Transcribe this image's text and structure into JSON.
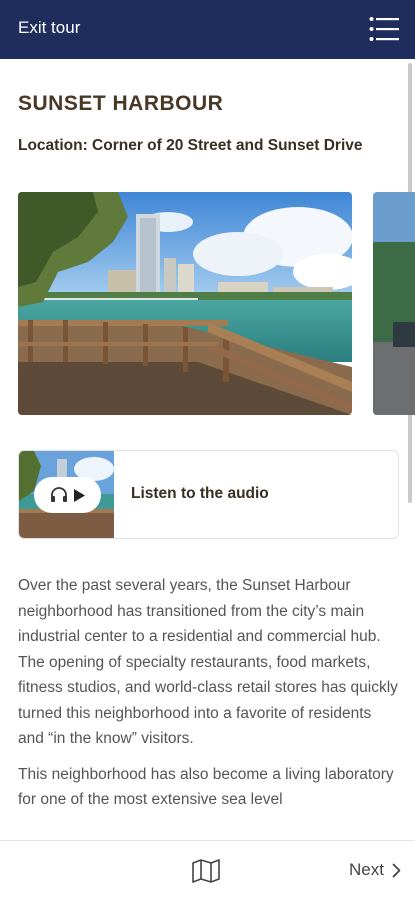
{
  "header": {
    "exit_label": "Exit tour",
    "menu_icon": "hamburger-menu-icon",
    "background": "#1f2d5c"
  },
  "stop": {
    "title": "SUNSET HARBOUR",
    "location": "Location: Corner of 20 Street and Sunset Drive"
  },
  "audio": {
    "label": "Listen to the audio",
    "icons": [
      "headphones-icon",
      "play-icon"
    ]
  },
  "body": {
    "paragraphs": [
      "Over the past several years, the Sunset Harbour neighborhood has transitioned from the city’s main industrial center to a residential and commercial hub. The opening of specialty restaurants, food markets, fitness studios, and world-class retail stores has quickly turned this neighborhood into a favorite of residents and “in the know” visitors.",
      "This neighborhood has also become a living laboratory for one of the most extensive sea level"
    ]
  },
  "footer": {
    "map_icon": "map-icon",
    "next_label": "Next",
    "next_icon": "chevron-right-icon"
  }
}
